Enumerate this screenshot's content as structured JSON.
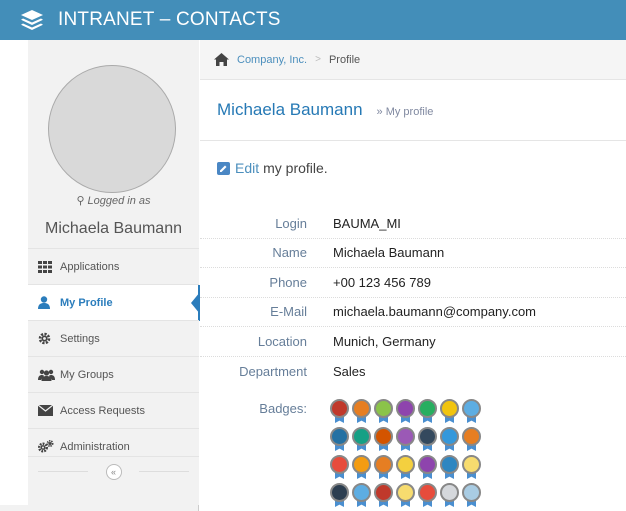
{
  "app": {
    "title": "INTRANET – CONTACTS"
  },
  "sidebar": {
    "logged_in_label": "Logged in as",
    "user_name": "Michaela Baumann",
    "items": [
      {
        "label": "Applications",
        "icon": "grid-icon",
        "active": false
      },
      {
        "label": "My Profile",
        "icon": "user-icon",
        "active": true
      },
      {
        "label": "Settings",
        "icon": "gear-icon",
        "active": false
      },
      {
        "label": "My Groups",
        "icon": "users-icon",
        "active": false
      },
      {
        "label": "Access Requests",
        "icon": "envelope-icon",
        "active": false
      },
      {
        "label": "Administration",
        "icon": "cogs-icon",
        "active": false
      }
    ],
    "collapse_glyph": "«"
  },
  "breadcrumb": {
    "company": "Company, Inc.",
    "separator": ">",
    "current": "Profile"
  },
  "header": {
    "title": "Michaela Baumann",
    "subtitle": "» My profile"
  },
  "edit": {
    "link": "Edit",
    "rest": "my profile."
  },
  "profile": {
    "fields": [
      {
        "label": "Login",
        "value": "BAUMA_MI"
      },
      {
        "label": "Name",
        "value": "Michaela Baumann"
      },
      {
        "label": "Phone",
        "value": "+00 123 456 789"
      },
      {
        "label": "E-Mail",
        "value": "michaela.baumann@company.com"
      },
      {
        "label": "Location",
        "value": "Munich, Germany"
      },
      {
        "label": "Department",
        "value": "Sales"
      }
    ],
    "badges_label": "Badges:",
    "badges": [
      "#c0392b",
      "#e67e22",
      "#8bc34a",
      "#8e44ad",
      "#27ae60",
      "#f1c40f",
      "#5dade2",
      "#2471a3",
      "#16a085",
      "#d35400",
      "#9b59b6",
      "#34495e",
      "#3498db",
      "#e67e22",
      "#e74c3c",
      "#f39c12",
      "#e67e22",
      "#f4d03f",
      "#8e44ad",
      "#2e86c1",
      "#f7dc6f",
      "#2c3e50",
      "#5dade2",
      "#c0392b",
      "#f7dc6f",
      "#e74c3c",
      "#d5d8dc",
      "#a9cce3"
    ]
  },
  "colors": {
    "topbar": "#438eb9",
    "accent": "#2b7dbc",
    "link": "#4c8fbd"
  }
}
